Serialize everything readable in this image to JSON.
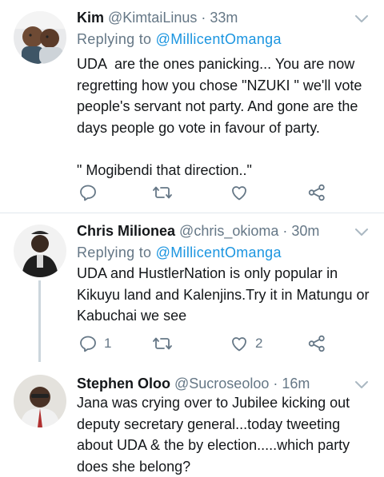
{
  "colors": {
    "text": "#14171a",
    "secondary": "#657786",
    "link": "#1b95e0",
    "divider": "#e1e8ed",
    "thread_line": "#ccd6dd"
  },
  "tweets": [
    {
      "name": "Kim",
      "handle": "@KimtaiLinus",
      "separator": "·",
      "time": "33m",
      "replying_label": "Replying to",
      "replying_to": "@MillicentOmanga",
      "text": "UDA  are the ones panicking... You are now regretting how you chose \"NZUKI \" we'll vote people's servant not party. And gone are the days people go vote in favour of party.\n\n\" Mogibendi that direction..\"",
      "icons": [
        "reply-icon",
        "retweet-icon",
        "like-icon",
        "share-icon"
      ],
      "reply_count": "",
      "retweet_count": "",
      "like_count": ""
    },
    {
      "name": "Chris Milionea",
      "handle": "@chris_okioma",
      "separator": "·",
      "time": "30m",
      "replying_label": "Replying to",
      "replying_to": "@MillicentOmanga",
      "text": "UDA and HustlerNation is only popular in Kikuyu land and Kalenjins.Try it in Matungu or Kabuchai we see",
      "icons": [
        "reply-icon",
        "retweet-icon",
        "like-icon",
        "share-icon"
      ],
      "reply_count": "1",
      "retweet_count": "",
      "like_count": "2"
    },
    {
      "name": "Stephen Oloo",
      "handle": "@Sucroseoloo",
      "separator": "·",
      "time": "16m",
      "text": "Jana was crying over to Jubilee kicking out deputy secretary general...today tweeting about UDA & the by election.....which party does she belong?"
    }
  ]
}
